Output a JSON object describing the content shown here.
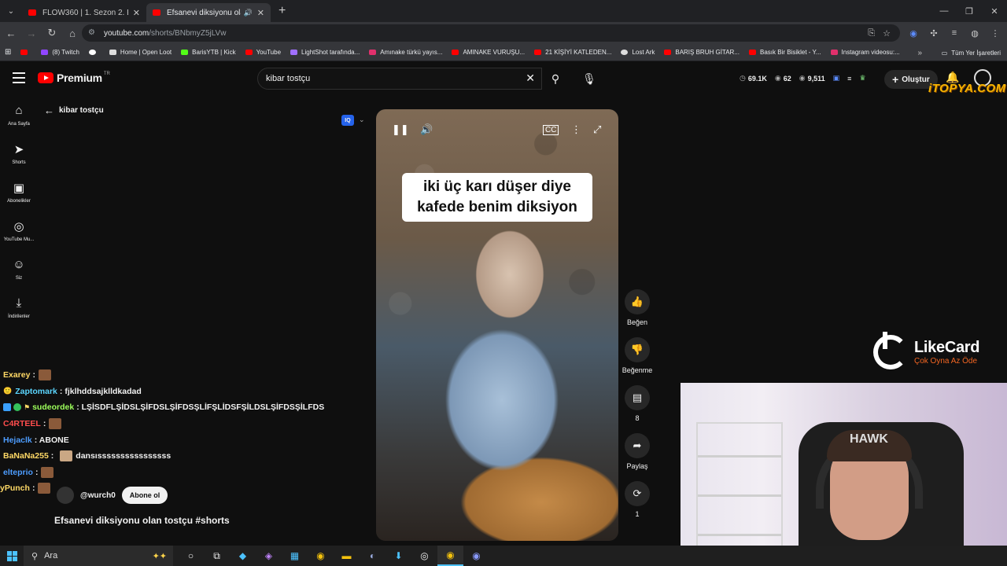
{
  "browser": {
    "tabs": [
      {
        "label": "FLOW360 | 1. Sezon 2. Bölüm -",
        "active": false
      },
      {
        "label": "Efsanevi diksiyonu olan tostç",
        "active": true
      }
    ],
    "url_domain": "youtube.com",
    "url_path": "/shorts/BNbmyZ5jLVw",
    "bookmarks": [
      "(8) Twitch",
      "Home | Open Loot",
      "BarisYTB | Kick",
      "YouTube",
      "LightShot tarafında...",
      "Amınake türkü yayıs...",
      "AMINAKE VURUŞU...",
      "21 KİŞİYİ KATLEDEN...",
      "Lost Ark",
      "BARIŞ BRUH GİTAR...",
      "Basık Bir Bisiklet - Y...",
      "Instagram videosu:..."
    ],
    "bookmarks_all": "Tüm Yer İşaretleri"
  },
  "youtube": {
    "logo_word": "Premium",
    "logo_region": "TR",
    "search_value": "kibar tostçu",
    "stats": {
      "views": "69.1K",
      "count2": "62",
      "count3": "9,511"
    },
    "create_label": "Oluştur",
    "sidebar": [
      {
        "icon": "home-icon",
        "glyph": "⌂",
        "label": "Ana Sayfa"
      },
      {
        "icon": "shorts-icon",
        "glyph": "➤",
        "label": "Shorts"
      },
      {
        "icon": "subscriptions-icon",
        "glyph": "▣",
        "label": "Abonelikler"
      },
      {
        "icon": "youtube-music-icon",
        "glyph": "◎",
        "label": "YouTube Mu..."
      },
      {
        "icon": "you-icon",
        "glyph": "☺",
        "label": "Siz"
      },
      {
        "icon": "downloads-icon",
        "glyph": "⤓",
        "label": "İndirilenler"
      }
    ],
    "back_label": "kibar tostçu",
    "iq_badge": "IQ",
    "video": {
      "caption_line1": "iki üç karı düşer diye",
      "caption_line2": "kafede benim diksiyon"
    },
    "actions": [
      {
        "name": "like",
        "glyph": "👍",
        "label": "Beğen"
      },
      {
        "name": "dislike",
        "glyph": "👎",
        "label": "Beğenme"
      },
      {
        "name": "comments",
        "glyph": "▤",
        "label": "8"
      },
      {
        "name": "share",
        "glyph": "➦",
        "label": "Paylaş"
      },
      {
        "name": "remix",
        "glyph": "⟳",
        "label": "1"
      }
    ],
    "channel": "@wurch0",
    "subscribe_label": "Abone ol",
    "title": "Efsanevi diksiyonu olan tostçu #shorts"
  },
  "chat": [
    {
      "user": "Exarey",
      "color": "#ffd966",
      "msg": ":",
      "emote": true
    },
    {
      "user": "Zaptomark",
      "color": "#5bd6ff",
      "msg": ": fjklhddsajklldkadad",
      "prefix": "🙂",
      "emote": false
    },
    {
      "user": "sudeordek",
      "color": "#ffd966",
      "msg": ": LŞİSDFLŞİDSLŞİFDSLŞİFDSŞLİFŞLİDSFŞİLDSLŞİFDSŞİLFDS",
      "prefix": "⚑",
      "emote": false
    },
    {
      "user": "C4RTEEL",
      "color": "#ff4d4d",
      "msg": ":",
      "emote": true
    },
    {
      "user": "Hejaclk",
      "color": "#4d9dff",
      "msg": ": ABONE",
      "emote": false
    },
    {
      "user": "BaNaNa255",
      "color": "#ffd966",
      "msg": ": dansıssssssssssssssss",
      "emote": false
    },
    {
      "user": "elteprio",
      "color": "#4d9dff",
      "msg": ":",
      "emote": true
    },
    {
      "user": "yPunch",
      "color": "#ffd966",
      "msg": ":",
      "emote": true
    }
  ],
  "sponsor": {
    "brand": "LikeCard",
    "tagline": "Çok Oyna  Az Öde"
  },
  "overlay_brand": "iTOPYA.COM",
  "webcam": {
    "headset_brand": "HAWK"
  },
  "taskbar": {
    "search_placeholder": "Ara"
  }
}
